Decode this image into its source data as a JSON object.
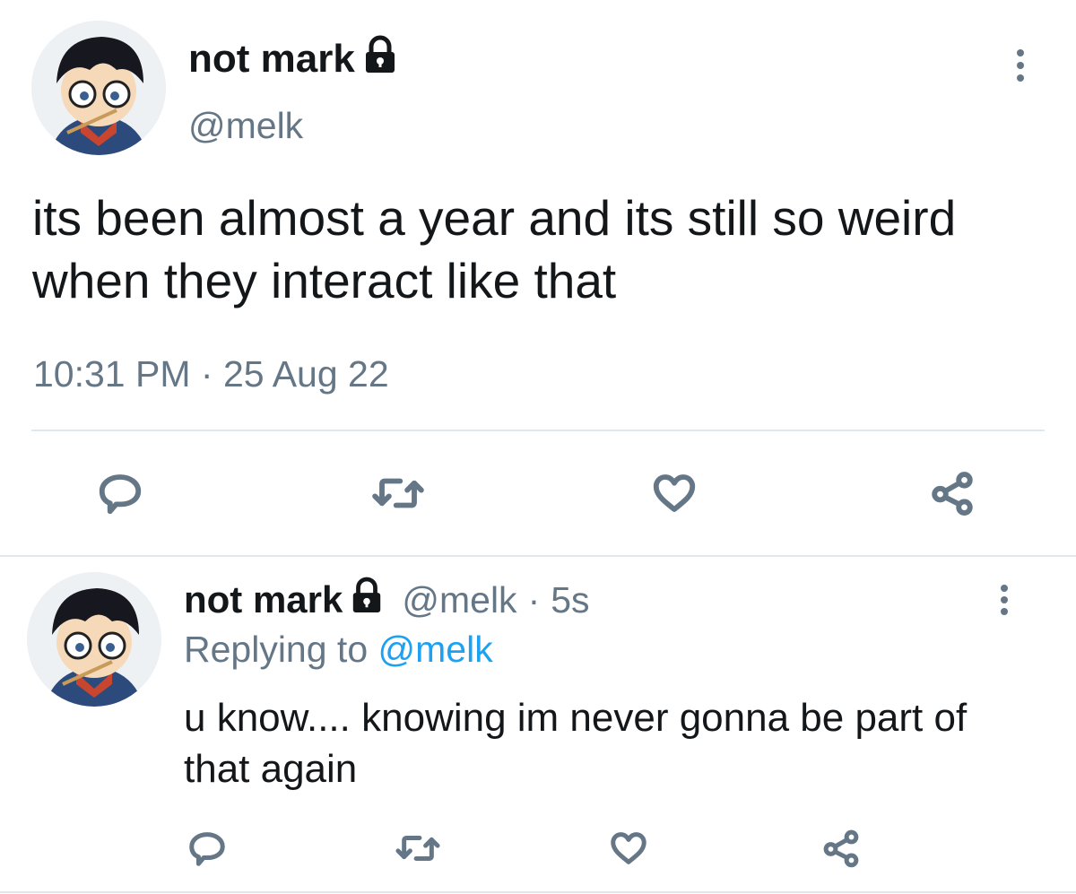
{
  "main_tweet": {
    "display_name": "not mark",
    "handle": "@melk",
    "text": "its been almost a year and its still so weird when they interact like that",
    "time": "10:31 PM",
    "separator": "·",
    "date": "25 Aug 22"
  },
  "reply_tweet": {
    "display_name": "not mark",
    "handle": "@melk",
    "separator": "·",
    "age": "5s",
    "replying_prefix": "Replying to",
    "replying_handle": "@melk",
    "text": "u know.... knowing im never gonna be part of that again"
  },
  "icons": {
    "lock": "lock-icon",
    "more": "more-vertical-icon",
    "reply": "reply-icon",
    "retweet": "retweet-icon",
    "like": "heart-icon",
    "share": "share-icon"
  },
  "colors": {
    "text": "#14171a",
    "secondary": "#657786",
    "link": "#1da1f2",
    "divider": "#e1e8ed"
  }
}
